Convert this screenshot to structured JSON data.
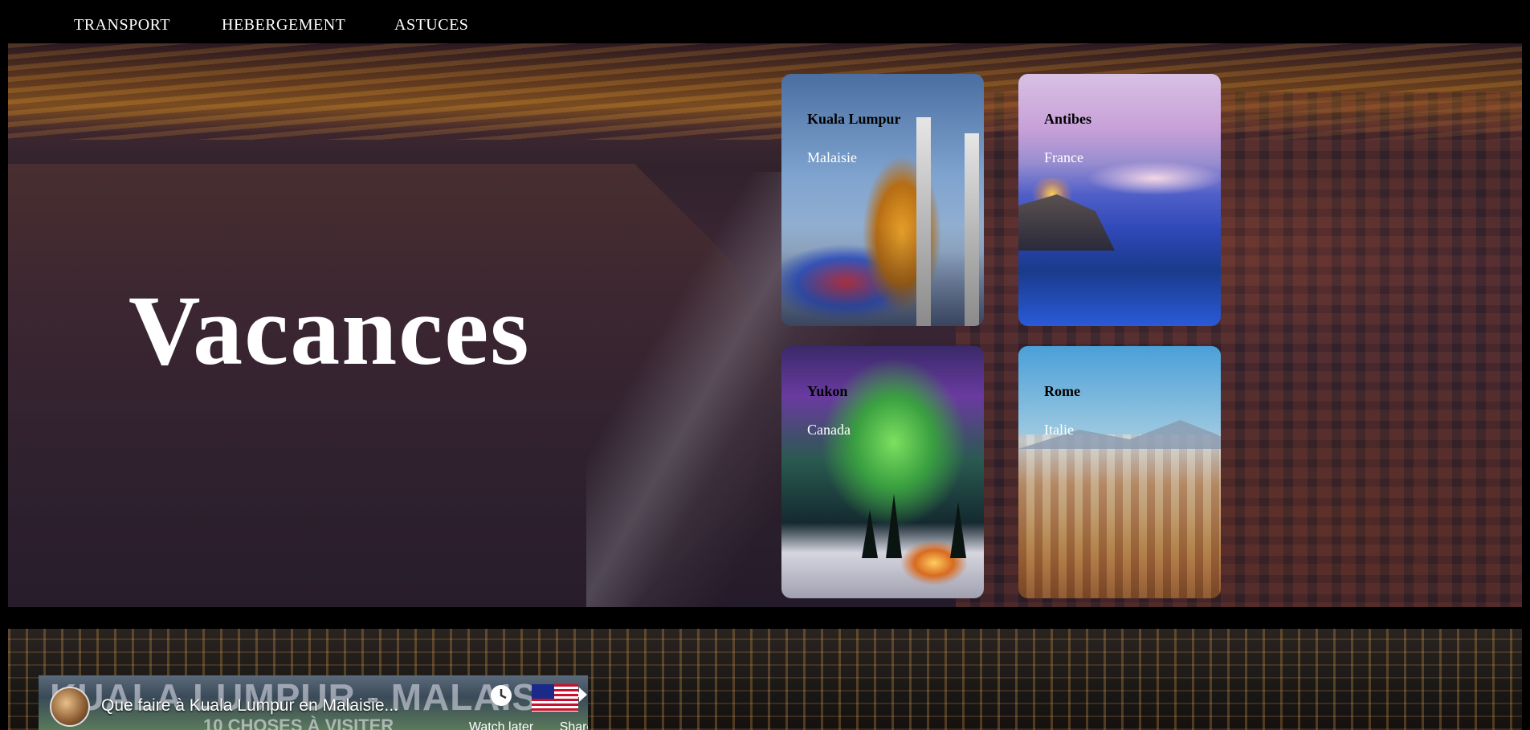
{
  "nav": {
    "items": [
      {
        "label": "TRANSPORT"
      },
      {
        "label": "HEBERGEMENT"
      },
      {
        "label": "ASTUCES"
      }
    ]
  },
  "hero": {
    "title": "Vacances"
  },
  "destinations": [
    {
      "city": "Kuala Lumpur",
      "country": "Malaisie"
    },
    {
      "city": "Antibes",
      "country": "France"
    },
    {
      "city": "Yukon",
      "country": "Canada"
    },
    {
      "city": "Rome",
      "country": "Italie"
    }
  ],
  "video": {
    "thumbnail_text": "KUALA LUMPUR - MALAISIE",
    "thumbnail_subtext": "10 CHOSES À VISITER",
    "title": "Que faire à Kuala Lumpur en Malaisie...",
    "watch_later_label": "Watch later",
    "share_label": "Share",
    "watch_later_icon": "clock-icon",
    "share_icon": "share-arrow-icon"
  }
}
